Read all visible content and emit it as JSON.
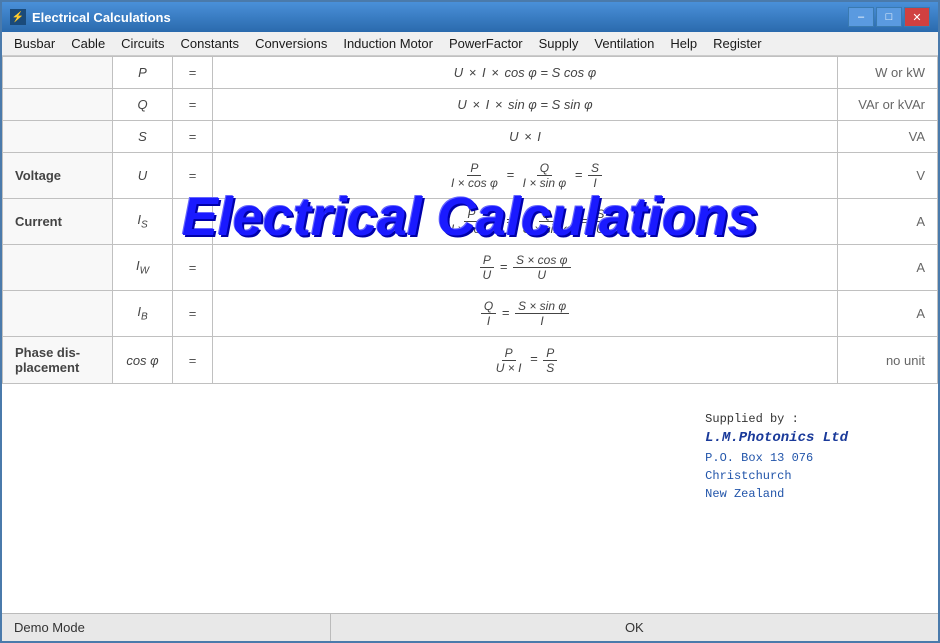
{
  "window": {
    "title": "Electrical Calculations",
    "title_icon": "⚡"
  },
  "titlebar": {
    "minimize_label": "–",
    "maximize_label": "□",
    "close_label": "✕"
  },
  "menubar": {
    "items": [
      {
        "label": "Busbar"
      },
      {
        "label": "Cable"
      },
      {
        "label": "Circuits"
      },
      {
        "label": "Constants"
      },
      {
        "label": "Conversions"
      },
      {
        "label": "Induction Motor"
      },
      {
        "label": "PowerFactor"
      },
      {
        "label": "Supply"
      },
      {
        "label": "Ventilation"
      },
      {
        "label": "Help"
      },
      {
        "label": "Register"
      }
    ]
  },
  "watermark": {
    "text": "Electrical Calculations"
  },
  "supplier": {
    "line1": "Supplied by :",
    "line2": "L.M.Photonics Ltd",
    "line3": "P.O. Box 13 076",
    "line4": "Christchurch",
    "line5": "New Zealand"
  },
  "statusbar": {
    "mode": "Demo Mode",
    "ok_label": "OK"
  },
  "table": {
    "rows": [
      {
        "label": "",
        "symbol": "P",
        "eq": "=",
        "formula": "U × I × cos φ = S cos φ",
        "unit": "W or kW"
      },
      {
        "label": "",
        "symbol": "Q",
        "eq": "=",
        "formula": "U × I × sin φ = S sin φ",
        "unit": "VAr or kVAr"
      },
      {
        "label": "",
        "symbol": "S",
        "eq": "=",
        "formula": "U × I",
        "unit": "VA"
      },
      {
        "label": "Voltage",
        "symbol": "U",
        "eq": "=",
        "formula": "P/(I×cosφ) = Q/(I×sinφ) = S/I",
        "unit": "V"
      },
      {
        "label": "Current",
        "symbol": "IS",
        "eq": "=",
        "formula": "P/(U×cosφ) = Q/(U×sinφ) = S/U",
        "unit": "A"
      },
      {
        "label": "",
        "symbol": "IW",
        "eq": "=",
        "formula": "P/U = S×cosφ/U",
        "unit": "A"
      },
      {
        "label": "",
        "symbol": "IB",
        "eq": "=",
        "formula": "Q/I = S×sinφ/I",
        "unit": "A"
      },
      {
        "label": "Phase displacement",
        "symbol": "cos φ",
        "eq": "=",
        "formula": "P/(U×I) = P/S",
        "unit": "no unit"
      }
    ]
  }
}
